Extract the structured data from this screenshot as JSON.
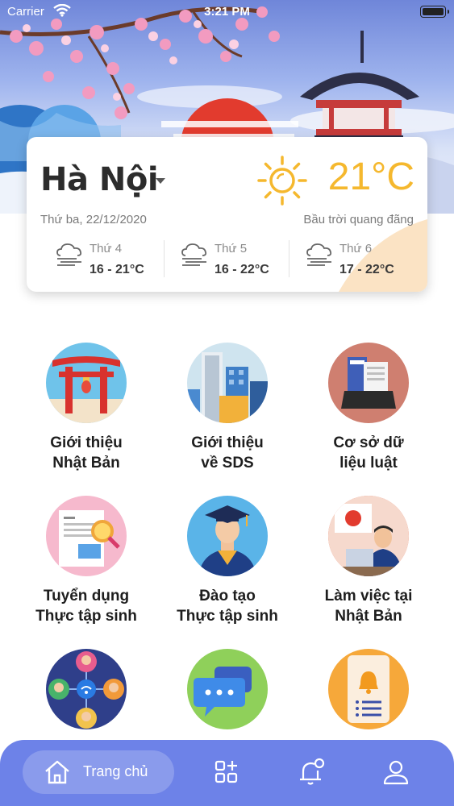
{
  "status_bar": {
    "carrier": "Carrier",
    "time": "3:21 PM"
  },
  "weather": {
    "city": "Hà Nội",
    "date": "Thứ ba, 22/12/2020",
    "temperature": "21°C",
    "condition": "Bầu trời quang đãng",
    "forecast": [
      {
        "day": "Thứ 4",
        "range": "16 - 21°C"
      },
      {
        "day": "Thứ 5",
        "range": "16 - 22°C"
      },
      {
        "day": "Thứ 6",
        "range": "17 - 22°C"
      }
    ],
    "colors": {
      "sun": "#f5b82e"
    }
  },
  "menu": [
    {
      "line1": "Giới thiệu",
      "line2": "Nhật Bản",
      "icon": "torii-gate-icon"
    },
    {
      "line1": "Giới thiệu",
      "line2": "về SDS",
      "icon": "buildings-icon"
    },
    {
      "line1": "Cơ sở dữ",
      "line2": "liệu luật",
      "icon": "document-tray-icon"
    },
    {
      "line1": "Tuyển dụng",
      "line2": "Thực tập sinh",
      "icon": "resume-magnifier-icon"
    },
    {
      "line1": "Đào tạo",
      "line2": "Thực tập sinh",
      "icon": "graduate-icon"
    },
    {
      "line1": "Làm việc tại",
      "line2": "Nhật Bản",
      "icon": "office-worker-icon"
    },
    {
      "line1": "",
      "line2": "",
      "icon": "network-people-icon"
    },
    {
      "line1": "",
      "line2": "",
      "icon": "chat-bubbles-icon"
    },
    {
      "line1": "",
      "line2": "",
      "icon": "notification-card-icon"
    }
  ],
  "bottom_nav": {
    "home_label": "Trang chủ",
    "items": [
      "home-icon",
      "grid-plus-icon",
      "bell-icon",
      "user-icon"
    ],
    "colors": {
      "bar": "#6d82e8",
      "active_pill": "#8a9bec"
    }
  }
}
